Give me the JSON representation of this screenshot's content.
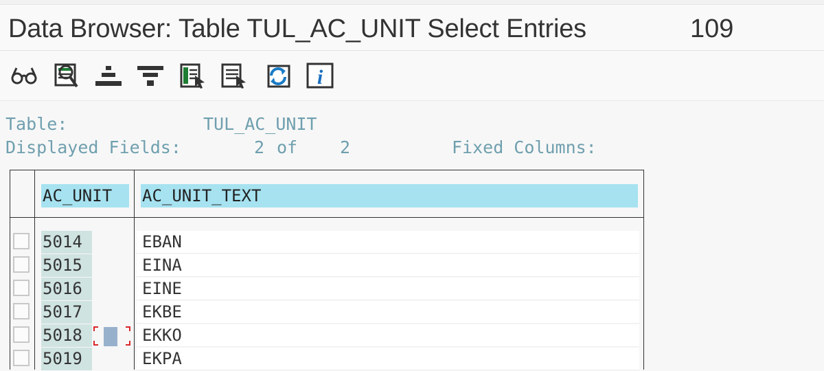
{
  "window": {
    "title": "Data Browser: Table TUL_AC_UNIT Select Entries",
    "entry_count": "109"
  },
  "toolbar": {
    "icons": [
      "glasses-icon",
      "inspect-list-icon",
      "sort-ascending-icon",
      "filter-icon",
      "select-green-icon",
      "select-grey-icon",
      "refresh-icon",
      "info-icon"
    ]
  },
  "info": {
    "table_label": "Table:",
    "table_value": "TUL_AC_UNIT",
    "displayed_label": "Displayed Fields:",
    "displayed_count": "2",
    "of_label": "of",
    "total_count": "2",
    "fixed_label": "Fixed Columns:"
  },
  "grid": {
    "columns": [
      "AC_UNIT",
      "AC_UNIT_TEXT"
    ],
    "rows": [
      {
        "ac_unit": "5014",
        "text": "EBAN"
      },
      {
        "ac_unit": "5015",
        "text": "EINA"
      },
      {
        "ac_unit": "5016",
        "text": "EINE"
      },
      {
        "ac_unit": "5017",
        "text": "EKBE"
      },
      {
        "ac_unit": "5018",
        "text": "EKKO"
      },
      {
        "ac_unit": "5019",
        "text": "EKPA"
      }
    ]
  },
  "colors": {
    "header_bg": "#a6e2f0",
    "key_bg": "#cfe3e1",
    "info_text": "#6f9fae",
    "cursor_marker": "#d9262c"
  }
}
